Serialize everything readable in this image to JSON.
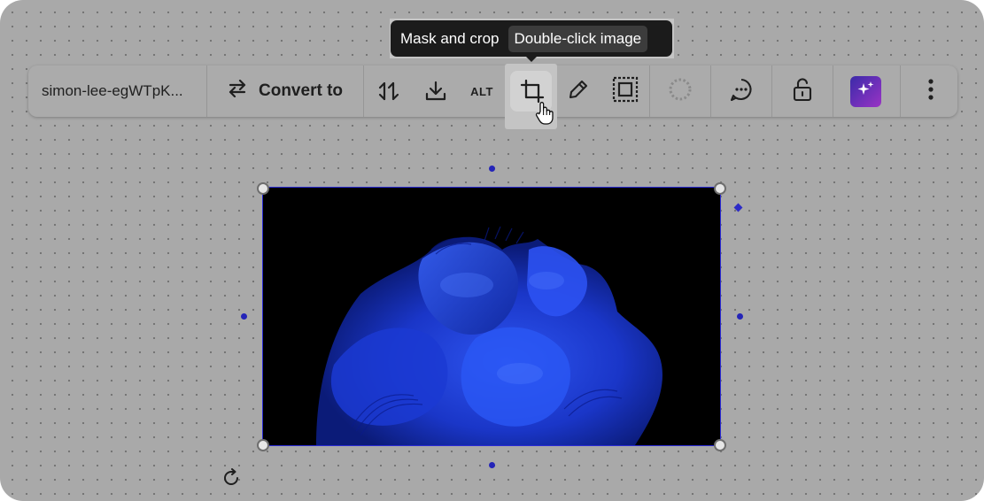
{
  "toolbar": {
    "file_name": "simon-lee-egWTpK...",
    "convert_label": "Convert to",
    "alt_label": "ALT",
    "buttons": {
      "swap": "swap-vertical-icon",
      "download": "download-icon",
      "crop": "crop-icon",
      "edit": "pencil-icon",
      "frame": "frame-icon",
      "loading": "loading-dots-icon",
      "comment": "comment-icon",
      "lock": "unlock-icon",
      "magic": "sparkles-icon",
      "more": "more-vertical-icon"
    }
  },
  "tooltip": {
    "title": "Mask and crop",
    "hint": "Double-click image"
  },
  "colors": {
    "canvas": "#a9a9a9",
    "selection": "#2b2bd6",
    "tooltip_bg": "#1b1b1b",
    "magic_gradient_start": "#3b2aa8",
    "magic_gradient_end": "#9a33c4"
  }
}
